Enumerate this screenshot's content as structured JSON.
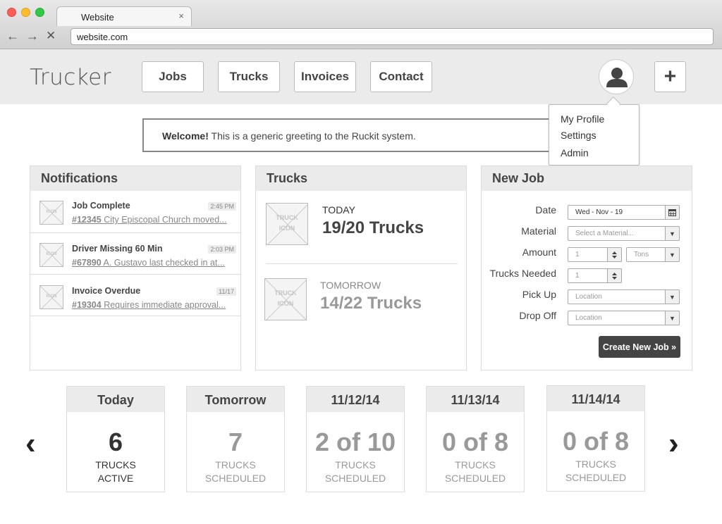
{
  "browser": {
    "tab_title": "Website",
    "tab_close": "×",
    "url": "website.com",
    "back": "←",
    "forward": "→",
    "stop": "✕"
  },
  "app": {
    "brand": "Trucker",
    "nav": [
      "Jobs",
      "Trucks",
      "Invoices",
      "Contact"
    ],
    "add_label": "+"
  },
  "profile_menu": {
    "items": [
      "My Profile",
      "Settings",
      "Admin"
    ]
  },
  "welcome": {
    "bold": "Welcome!",
    "text": "This is a generic greeting to the Ruckit system."
  },
  "notifications": {
    "title": "Notifications",
    "icon_label": "ICON",
    "items": [
      {
        "title": "Job Complete",
        "time": "2:45 PM",
        "ref": "#12345",
        "detail": "City Episcopal Church moved..."
      },
      {
        "title": "Driver Missing 60 Min",
        "time": "2:03 PM",
        "ref": "#67890",
        "detail": "A. Gustavo last checked in at..."
      },
      {
        "title": "Invoice Overdue",
        "time": "11/17",
        "ref": "#19304",
        "detail": "Requires immediate approval..."
      }
    ]
  },
  "trucks": {
    "title": "Trucks",
    "icon_label_1": "TRUCK",
    "icon_label_2": "ICON",
    "rows": [
      {
        "label": "TODAY",
        "value": "19/20 Trucks"
      },
      {
        "label": "TOMORROW",
        "value": "14/22 Trucks"
      }
    ]
  },
  "new_job": {
    "title": "New Job",
    "date_label": "Date",
    "date_value": "Wed - Nov - 19",
    "material_label": "Material",
    "material_placeholder": "Select a Material...",
    "amount_label": "Amount",
    "amount_value": "1",
    "unit_value": "Tons",
    "trucks_label": "Trucks Needed",
    "trucks_value": "1",
    "pickup_label": "Pick Up",
    "pickup_placeholder": "Location",
    "dropoff_label": "Drop Off",
    "dropoff_placeholder": "Location",
    "submit": "Create New Job »"
  },
  "days": {
    "prev": "‹",
    "next": "›",
    "items": [
      {
        "head": "Today",
        "value": "6",
        "line1": "TRUCKS",
        "line2": "ACTIVE"
      },
      {
        "head": "Tomorrow",
        "value": "7",
        "line1": "TRUCKS",
        "line2": "SCHEDULED"
      },
      {
        "head": "11/12/14",
        "value": "2 of 10",
        "line1": "TRUCKS",
        "line2": "SCHEDULED"
      },
      {
        "head": "11/13/14",
        "value": "0 of 8",
        "line1": "TRUCKS",
        "line2": "SCHEDULED"
      },
      {
        "head": "11/14/14",
        "value": "0 of 8",
        "line1": "TRUCKS",
        "line2": "SCHEDULED"
      }
    ]
  }
}
